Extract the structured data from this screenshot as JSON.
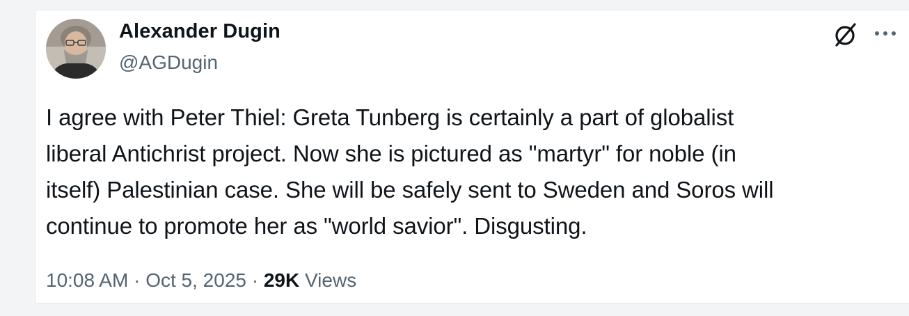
{
  "author": {
    "name": "Alexander Dugin",
    "handle": "@AGDugin",
    "avatar_icon": "user-avatar-photo"
  },
  "actions": {
    "grok_icon": "grok-icon",
    "more_icon": "more-icon"
  },
  "tweet": {
    "text": "I agree with Peter Thiel: Greta Tunberg is certainly a part of globalist\nliberal Antichrist project. Now she is pictured as \"martyr\" for noble (in\nitself) Palestinian case. She will be safely sent to Sweden and Soros will\ncontinue to promote her as \"world savior\". Disgusting."
  },
  "meta": {
    "time": "10:08 AM",
    "sep1": " · ",
    "date": "Oct 5, 2025",
    "sep2": " · ",
    "views_count": "29K",
    "views_label": " Views"
  },
  "colors": {
    "text_primary": "#0f1419",
    "text_secondary": "#536471",
    "background": "#f3f4f6"
  }
}
